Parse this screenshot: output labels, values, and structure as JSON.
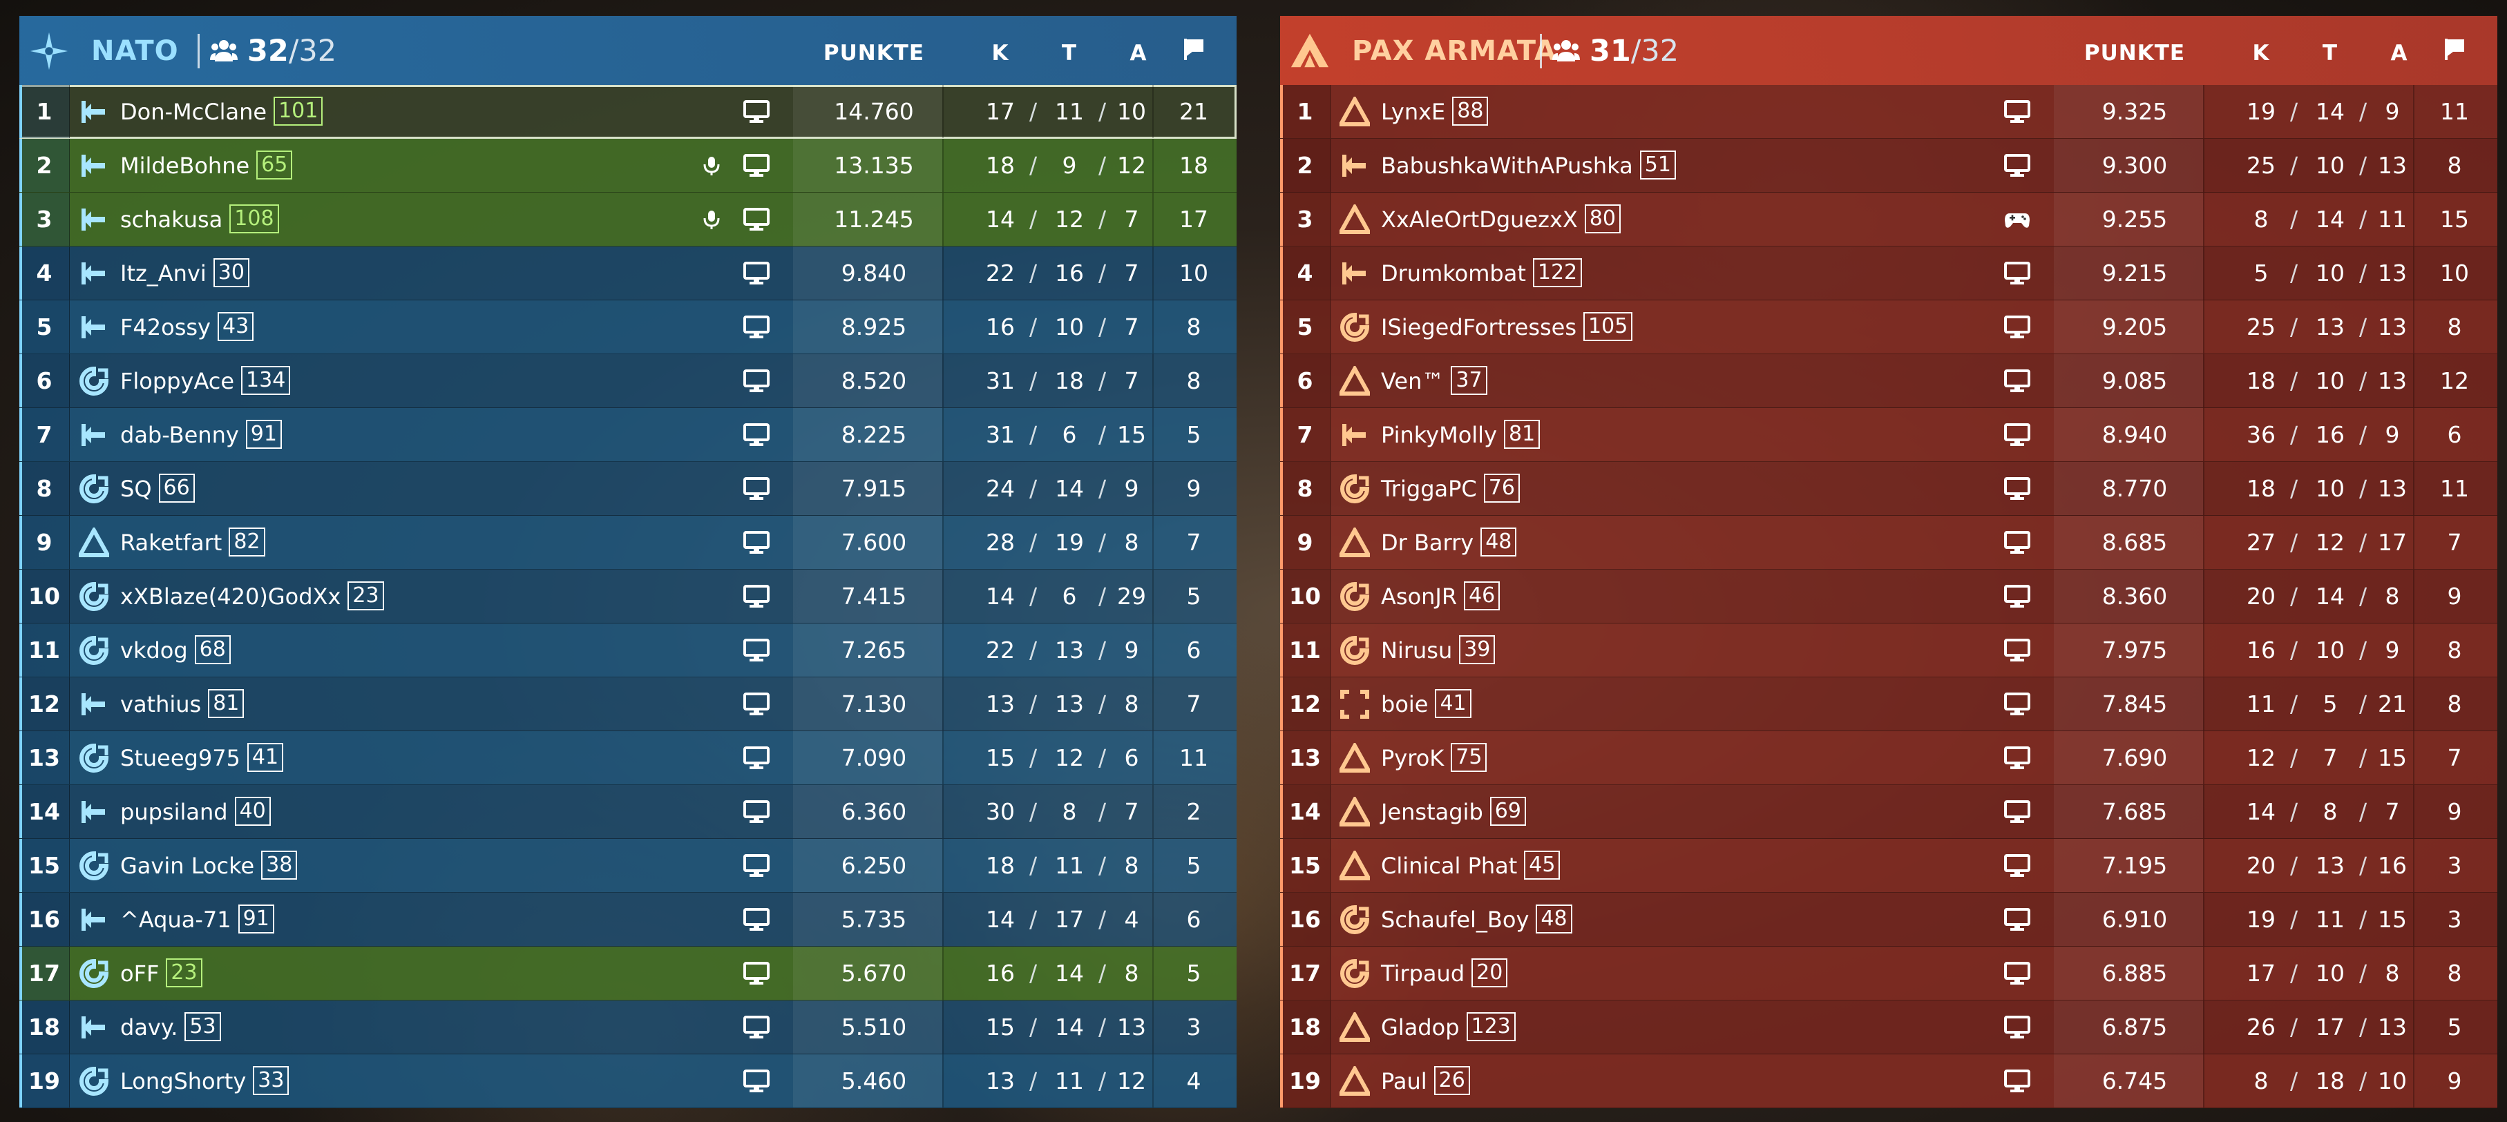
{
  "columns": {
    "score": "PUNKTE",
    "kills": "K",
    "deaths": "T",
    "assists": "A"
  },
  "teams": [
    {
      "name": "NATO",
      "count_current": "32",
      "count_max": "/32",
      "accent": "#7fd4ff",
      "players": [
        {
          "rank": "1",
          "name": "Don-McClane",
          "level": "101",
          "cls": "support",
          "score": "14.760",
          "k": "17",
          "t": "11",
          "a": "10",
          "obj": "21",
          "state": "self",
          "platform": "pc"
        },
        {
          "rank": "2",
          "name": "MildeBohne",
          "level": "65",
          "cls": "support",
          "score": "13.135",
          "k": "18",
          "t": "9",
          "a": "12",
          "obj": "18",
          "state": "squad",
          "mic": true,
          "platform": "pc"
        },
        {
          "rank": "3",
          "name": "schakusa",
          "level": "108",
          "cls": "support",
          "score": "11.245",
          "k": "14",
          "t": "12",
          "a": "7",
          "obj": "17",
          "state": "squad",
          "mic": true,
          "platform": "pc"
        },
        {
          "rank": "4",
          "name": "Itz_Anvi",
          "level": "30",
          "cls": "support",
          "score": "9.840",
          "k": "22",
          "t": "16",
          "a": "7",
          "obj": "10",
          "platform": "pc"
        },
        {
          "rank": "5",
          "name": "F42ossy",
          "level": "43",
          "cls": "support",
          "score": "8.925",
          "k": "16",
          "t": "10",
          "a": "7",
          "obj": "8",
          "platform": "pc"
        },
        {
          "rank": "6",
          "name": "FloppyAce",
          "level": "134",
          "cls": "engineer",
          "score": "8.520",
          "k": "31",
          "t": "18",
          "a": "7",
          "obj": "8",
          "platform": "pc"
        },
        {
          "rank": "7",
          "name": "dab-Benny",
          "level": "91",
          "cls": "support",
          "score": "8.225",
          "k": "31",
          "t": "6",
          "a": "15",
          "obj": "5",
          "platform": "pc"
        },
        {
          "rank": "8",
          "name": "SQ",
          "level": "66",
          "cls": "engineer",
          "score": "7.915",
          "k": "24",
          "t": "14",
          "a": "9",
          "obj": "9",
          "platform": "pc"
        },
        {
          "rank": "9",
          "name": "Raketfart",
          "level": "82",
          "cls": "assault",
          "score": "7.600",
          "k": "28",
          "t": "19",
          "a": "8",
          "obj": "7",
          "platform": "pc"
        },
        {
          "rank": "10",
          "name": "xXBlaze(420)GodXx",
          "level": "23",
          "cls": "engineer",
          "score": "7.415",
          "k": "14",
          "t": "6",
          "a": "29",
          "obj": "5",
          "platform": "pc"
        },
        {
          "rank": "11",
          "name": "vkdog",
          "level": "68",
          "cls": "engineer",
          "score": "7.265",
          "k": "22",
          "t": "13",
          "a": "9",
          "obj": "6",
          "platform": "pc"
        },
        {
          "rank": "12",
          "name": "vathius",
          "level": "81",
          "cls": "support",
          "score": "7.130",
          "k": "13",
          "t": "13",
          "a": "8",
          "obj": "7",
          "platform": "pc"
        },
        {
          "rank": "13",
          "name": "Stueeg975",
          "level": "41",
          "cls": "engineer",
          "score": "7.090",
          "k": "15",
          "t": "12",
          "a": "6",
          "obj": "11",
          "platform": "pc"
        },
        {
          "rank": "14",
          "name": "pupsiland",
          "level": "40",
          "cls": "support",
          "score": "6.360",
          "k": "30",
          "t": "8",
          "a": "7",
          "obj": "2",
          "platform": "pc"
        },
        {
          "rank": "15",
          "name": "Gavin Locke",
          "level": "38",
          "cls": "engineer",
          "score": "6.250",
          "k": "18",
          "t": "11",
          "a": "8",
          "obj": "5",
          "platform": "pc"
        },
        {
          "rank": "16",
          "name": "^Aqua-71",
          "level": "91",
          "cls": "support",
          "score": "5.735",
          "k": "14",
          "t": "17",
          "a": "4",
          "obj": "6",
          "platform": "pc"
        },
        {
          "rank": "17",
          "name": "oFF",
          "level": "23",
          "cls": "engineer",
          "score": "5.670",
          "k": "16",
          "t": "14",
          "a": "8",
          "obj": "5",
          "state": "squad",
          "platform": "pc"
        },
        {
          "rank": "18",
          "name": "davy.",
          "level": "53",
          "cls": "support",
          "score": "5.510",
          "k": "15",
          "t": "14",
          "a": "13",
          "obj": "3",
          "platform": "pc"
        },
        {
          "rank": "19",
          "name": "LongShorty",
          "level": "33",
          "cls": "engineer",
          "score": "5.460",
          "k": "13",
          "t": "11",
          "a": "12",
          "obj": "4",
          "platform": "pc"
        }
      ]
    },
    {
      "name": "PAX ARMATA",
      "count_current": "31",
      "count_max": "/32",
      "accent": "#ff9a6a",
      "players": [
        {
          "rank": "1",
          "name": "LynxE",
          "level": "88",
          "cls": "assault",
          "score": "9.325",
          "k": "19",
          "t": "14",
          "a": "9",
          "obj": "11",
          "platform": "pc"
        },
        {
          "rank": "2",
          "name": "BabushkaWithAPushka",
          "level": "51",
          "cls": "support",
          "score": "9.300",
          "k": "25",
          "t": "10",
          "a": "13",
          "obj": "8",
          "platform": "pc"
        },
        {
          "rank": "3",
          "name": "XxAleOrtDguezxX",
          "level": "80",
          "cls": "assault",
          "score": "9.255",
          "k": "8",
          "t": "14",
          "a": "11",
          "obj": "15",
          "platform": "console"
        },
        {
          "rank": "4",
          "name": "Drumkombat",
          "level": "122",
          "cls": "support",
          "score": "9.215",
          "k": "5",
          "t": "10",
          "a": "13",
          "obj": "10",
          "platform": "pc"
        },
        {
          "rank": "5",
          "name": "ISiegedFortresses",
          "level": "105",
          "cls": "engineer",
          "score": "9.205",
          "k": "25",
          "t": "13",
          "a": "13",
          "obj": "8",
          "platform": "pc"
        },
        {
          "rank": "6",
          "name": "Ven™",
          "level": "37",
          "cls": "assault",
          "score": "9.085",
          "k": "18",
          "t": "10",
          "a": "13",
          "obj": "12",
          "platform": "pc"
        },
        {
          "rank": "7",
          "name": "PinkyMolly",
          "level": "81",
          "cls": "support",
          "score": "8.940",
          "k": "36",
          "t": "16",
          "a": "9",
          "obj": "6",
          "platform": "pc"
        },
        {
          "rank": "8",
          "name": "TriggaPC",
          "level": "76",
          "cls": "engineer",
          "score": "8.770",
          "k": "18",
          "t": "10",
          "a": "13",
          "obj": "11",
          "platform": "pc"
        },
        {
          "rank": "9",
          "name": "Dr Barry",
          "level": "48",
          "cls": "assault",
          "score": "8.685",
          "k": "27",
          "t": "12",
          "a": "17",
          "obj": "7",
          "platform": "pc"
        },
        {
          "rank": "10",
          "name": "AsonJR",
          "level": "46",
          "cls": "engineer",
          "score": "8.360",
          "k": "20",
          "t": "14",
          "a": "8",
          "obj": "9",
          "platform": "pc"
        },
        {
          "rank": "11",
          "name": "Nirusu",
          "level": "39",
          "cls": "engineer",
          "score": "7.975",
          "k": "16",
          "t": "10",
          "a": "9",
          "obj": "8",
          "platform": "pc"
        },
        {
          "rank": "12",
          "name": "boie",
          "level": "41",
          "cls": "recon",
          "score": "7.845",
          "k": "11",
          "t": "5",
          "a": "21",
          "obj": "8",
          "platform": "pc"
        },
        {
          "rank": "13",
          "name": "PyroK",
          "level": "75",
          "cls": "assault",
          "score": "7.690",
          "k": "12",
          "t": "7",
          "a": "15",
          "obj": "7",
          "platform": "pc"
        },
        {
          "rank": "14",
          "name": "Jenstagib",
          "level": "69",
          "cls": "assault",
          "score": "7.685",
          "k": "14",
          "t": "8",
          "a": "7",
          "obj": "9",
          "platform": "pc"
        },
        {
          "rank": "15",
          "name": "Clinical Phat",
          "level": "45",
          "cls": "assault",
          "score": "7.195",
          "k": "20",
          "t": "13",
          "a": "16",
          "obj": "3",
          "platform": "pc"
        },
        {
          "rank": "16",
          "name": "Schaufel_Boy",
          "level": "48",
          "cls": "engineer",
          "score": "6.910",
          "k": "19",
          "t": "11",
          "a": "15",
          "obj": "3",
          "platform": "pc"
        },
        {
          "rank": "17",
          "name": "Tirpaud",
          "level": "20",
          "cls": "engineer",
          "score": "6.885",
          "k": "17",
          "t": "10",
          "a": "8",
          "obj": "8",
          "platform": "pc"
        },
        {
          "rank": "18",
          "name": "Gladop",
          "level": "123",
          "cls": "assault",
          "score": "6.875",
          "k": "26",
          "t": "17",
          "a": "13",
          "obj": "5",
          "platform": "pc"
        },
        {
          "rank": "19",
          "name": "Paul",
          "level": "26",
          "cls": "assault",
          "score": "6.745",
          "k": "8",
          "t": "18",
          "a": "10",
          "obj": "9",
          "platform": "pc"
        }
      ]
    }
  ]
}
